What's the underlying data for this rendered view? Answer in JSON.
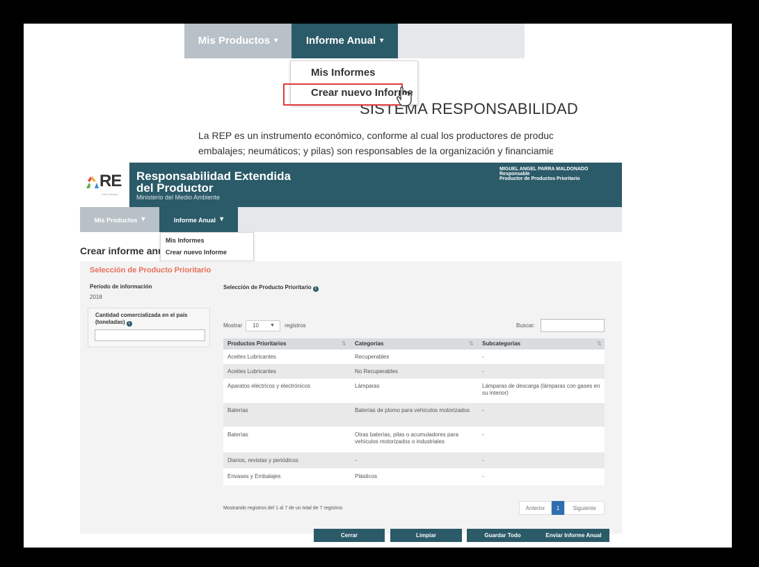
{
  "zoom": {
    "nav": {
      "mis_productos": "Mis Productos",
      "informe_anual": "Informe Anual"
    },
    "dropdown": {
      "mis_informes": "Mis Informes",
      "crear_nuevo": "Crear nuevo Informe"
    },
    "system_title": "SISTEMA RESPONSABILIDAD",
    "intro_line1": "La REP es un instrumento económico, conforme al cual los productores de produc",
    "intro_line2": "embalajes; neumáticos; y pilas) son responsables de la organización y financiamie"
  },
  "header": {
    "logo_text": "RE",
    "logo_sub": "Chile Recicla",
    "title_line1": "Responsabilidad Extendida",
    "title_line2": "del Productor",
    "subtitle": "Ministerio del Medio Ambiente",
    "user_name": "MIGUEL ANGEL PARRA MALDONADO",
    "user_role": "Responsable",
    "user_type": "Productor de Productos Prioritario"
  },
  "nav": {
    "mis_productos": "Mis Productos",
    "informe_anual": "Informe Anual"
  },
  "dropdown": {
    "mis_informes": "Mis Informes",
    "crear_nuevo": "Crear nuevo Informe"
  },
  "page_title": "Crear informe anual",
  "form": {
    "section_title": "Selección de Producto Prioritario",
    "period_label": "Período de información",
    "period_value": "2018",
    "qty_label": "Cantidad comercializada en el país (toneladas)",
    "qty_value": "",
    "product_select_label": "Selección de Producto Prioritario",
    "show_label": "Mostrar",
    "show_value": "10",
    "records_label": "registros",
    "search_label": "Buscar:",
    "search_value": ""
  },
  "table": {
    "headers": [
      "Productos Prioritarios",
      "Categorías",
      "Subcategorías"
    ],
    "rows": [
      [
        "Aceites Lubricantes",
        "Recuperables",
        "-"
      ],
      [
        "Aceites Lubricantes",
        "No Recuperables",
        "-"
      ],
      [
        "Aparatos eléctricos y electrónicos",
        "Lámparas",
        "Lámparas de descarga (lámparas con gases en su interior)"
      ],
      [
        "Baterías",
        "Baterías de plomo para vehículos motorizados",
        "-"
      ],
      [
        "Baterías",
        "Otras baterías, pilas o acumuladores para vehículos motorizados o industriales",
        "-"
      ],
      [
        "Diarios, revistas y periódicos",
        "-",
        "-"
      ],
      [
        "Envases y Embalajes",
        "Plásticos",
        "-"
      ]
    ],
    "info": "Mostrando registros del 1 al 7 de un total de 7 registros",
    "pager": {
      "prev": "Anterior",
      "current": "1",
      "next": "Siguiente"
    }
  },
  "buttons": {
    "cerrar": "Cerrar",
    "limpiar": "Limpiar",
    "guardar": "Guardar Todo",
    "enviar": "Enviar Informe Anual"
  },
  "colors": {
    "primary": "#2b5a68",
    "accent": "#e8705a",
    "highlight": "#e23b3b"
  }
}
